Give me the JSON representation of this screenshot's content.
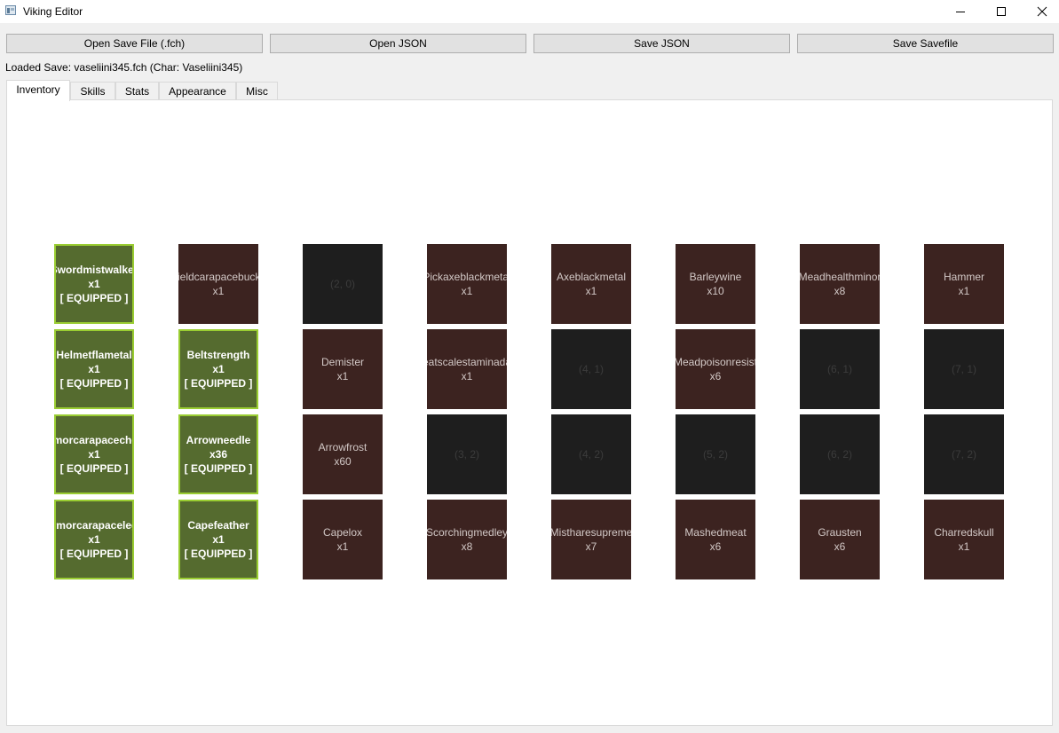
{
  "window": {
    "title": "Viking Editor"
  },
  "toolbar": {
    "open_save": "Open Save File (.fch)",
    "open_json": "Open JSON",
    "save_json": "Save JSON",
    "save_savefile": "Save Savefile"
  },
  "status": {
    "loaded": "Loaded Save: vaseliini345.fch (Char: Vaseliini345)"
  },
  "tabs": [
    "Inventory",
    "Skills",
    "Stats",
    "Appearance",
    "Misc"
  ],
  "inventory": {
    "equipped_label": "[ EQUIPPED ]",
    "colors": {
      "equipped_bg": "#556b2f",
      "equipped_border": "#9acd32",
      "item_bg": "#3c2320",
      "empty_bg": "#1e1e1e"
    },
    "slots": [
      {
        "col": 0,
        "row": 0,
        "type": "equipped",
        "name": "Swordmistwalker",
        "qty": "x1"
      },
      {
        "col": 1,
        "row": 0,
        "type": "item",
        "name": "Shieldcarapacebuckler",
        "qty": "x1"
      },
      {
        "col": 2,
        "row": 0,
        "type": "empty",
        "name": "(2, 0)"
      },
      {
        "col": 3,
        "row": 0,
        "type": "item",
        "name": "Pickaxeblackmetal",
        "qty": "x1"
      },
      {
        "col": 4,
        "row": 0,
        "type": "item",
        "name": "Axeblackmetal",
        "qty": "x1"
      },
      {
        "col": 5,
        "row": 0,
        "type": "item",
        "name": "Barleywine",
        "qty": "x10"
      },
      {
        "col": 6,
        "row": 0,
        "type": "item",
        "name": "Meadhealthminor",
        "qty": "x8"
      },
      {
        "col": 7,
        "row": 0,
        "type": "item",
        "name": "Hammer",
        "qty": "x1"
      },
      {
        "col": 0,
        "row": 1,
        "type": "equipped",
        "name": "Helmetflametal",
        "qty": "x1"
      },
      {
        "col": 1,
        "row": 1,
        "type": "equipped",
        "name": "Beltstrength",
        "qty": "x1"
      },
      {
        "col": 2,
        "row": 1,
        "type": "item",
        "name": "Demister",
        "qty": "x1"
      },
      {
        "col": 3,
        "row": 1,
        "type": "item",
        "name": "Meatscalestaminadapt",
        "qty": "x1"
      },
      {
        "col": 4,
        "row": 1,
        "type": "empty",
        "name": "(4, 1)"
      },
      {
        "col": 5,
        "row": 1,
        "type": "item",
        "name": "Meadpoisonresist",
        "qty": "x6"
      },
      {
        "col": 6,
        "row": 1,
        "type": "empty",
        "name": "(6, 1)"
      },
      {
        "col": 7,
        "row": 1,
        "type": "empty",
        "name": "(7, 1)"
      },
      {
        "col": 0,
        "row": 2,
        "type": "equipped",
        "name": "Armorcarapacechest",
        "qty": "x1"
      },
      {
        "col": 1,
        "row": 2,
        "type": "equipped",
        "name": "Arrowneedle",
        "qty": "x36"
      },
      {
        "col": 2,
        "row": 2,
        "type": "item",
        "name": "Arrowfrost",
        "qty": "x60"
      },
      {
        "col": 3,
        "row": 2,
        "type": "empty",
        "name": "(3, 2)"
      },
      {
        "col": 4,
        "row": 2,
        "type": "empty",
        "name": "(4, 2)"
      },
      {
        "col": 5,
        "row": 2,
        "type": "empty",
        "name": "(5, 2)"
      },
      {
        "col": 6,
        "row": 2,
        "type": "empty",
        "name": "(6, 2)"
      },
      {
        "col": 7,
        "row": 2,
        "type": "empty",
        "name": "(7, 2)"
      },
      {
        "col": 0,
        "row": 3,
        "type": "equipped",
        "name": "Armorcarapacelegs",
        "qty": "x1"
      },
      {
        "col": 1,
        "row": 3,
        "type": "equipped",
        "name": "Capefeather",
        "qty": "x1"
      },
      {
        "col": 2,
        "row": 3,
        "type": "item",
        "name": "Capelox",
        "qty": "x1"
      },
      {
        "col": 3,
        "row": 3,
        "type": "item",
        "name": "Scorchingmedley",
        "qty": "x8"
      },
      {
        "col": 4,
        "row": 3,
        "type": "item",
        "name": "Mistharesupreme",
        "qty": "x7"
      },
      {
        "col": 5,
        "row": 3,
        "type": "item",
        "name": "Mashedmeat",
        "qty": "x6"
      },
      {
        "col": 6,
        "row": 3,
        "type": "item",
        "name": "Grausten",
        "qty": "x6"
      },
      {
        "col": 7,
        "row": 3,
        "type": "item",
        "name": "Charredskull",
        "qty": "x1"
      }
    ]
  }
}
